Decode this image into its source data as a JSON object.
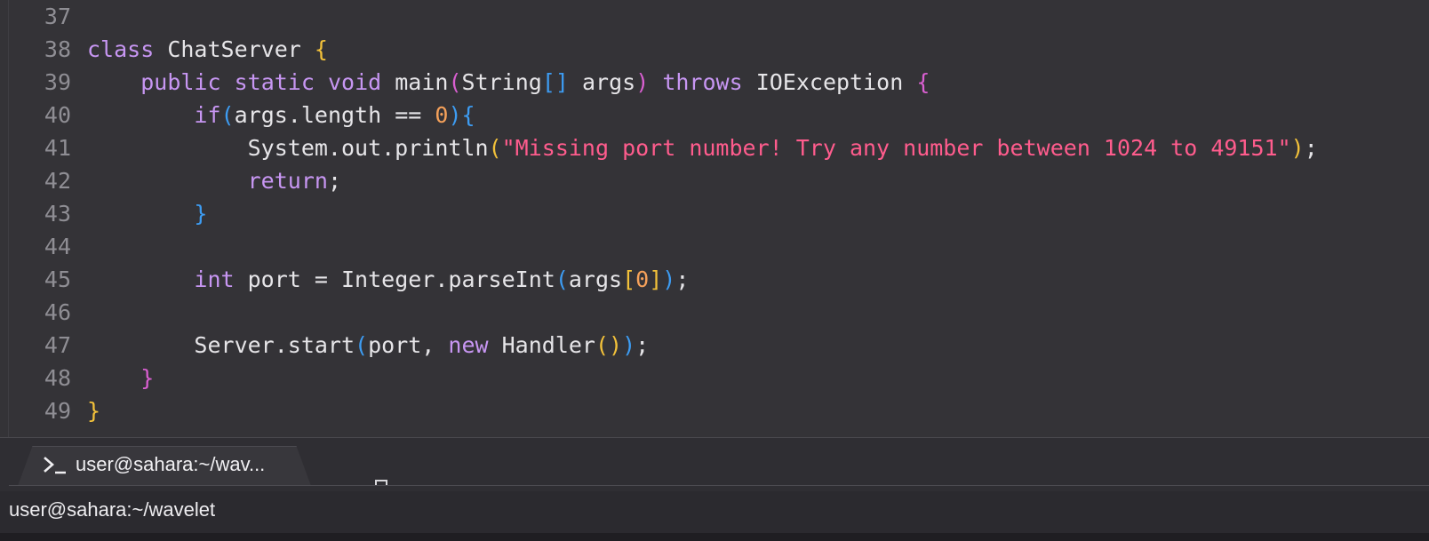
{
  "editor": {
    "lines": [
      {
        "n": "37",
        "tokens": []
      },
      {
        "n": "38",
        "tokens": [
          [
            "kw",
            "class"
          ],
          [
            "pt",
            " ChatServer "
          ],
          [
            "py",
            "{"
          ]
        ]
      },
      {
        "n": "39",
        "tokens": [
          [
            "pt",
            "    "
          ],
          [
            "kw",
            "public"
          ],
          [
            "pt",
            " "
          ],
          [
            "kw",
            "static"
          ],
          [
            "pt",
            " "
          ],
          [
            "kw",
            "void"
          ],
          [
            "pt",
            " main"
          ],
          [
            "pp",
            "("
          ],
          [
            "pt",
            "String"
          ],
          [
            "pb",
            "[]"
          ],
          [
            "pt",
            " args"
          ],
          [
            "pp",
            ")"
          ],
          [
            "pt",
            " "
          ],
          [
            "kw",
            "throws"
          ],
          [
            "pt",
            " IOException "
          ],
          [
            "pp",
            "{"
          ]
        ]
      },
      {
        "n": "40",
        "tokens": [
          [
            "pt",
            "        "
          ],
          [
            "kw",
            "if"
          ],
          [
            "pb",
            "("
          ],
          [
            "pt",
            "args.length == "
          ],
          [
            "nu",
            "0"
          ],
          [
            "pb",
            "){"
          ]
        ]
      },
      {
        "n": "41",
        "tokens": [
          [
            "pt",
            "            System.out.println"
          ],
          [
            "py",
            "("
          ],
          [
            "st",
            "\"Missing port number! Try any number between 1024 to 49151\""
          ],
          [
            "py",
            ")"
          ],
          [
            "pt",
            ";"
          ]
        ]
      },
      {
        "n": "42",
        "tokens": [
          [
            "pt",
            "            "
          ],
          [
            "kw",
            "return"
          ],
          [
            "pt",
            ";"
          ]
        ]
      },
      {
        "n": "43",
        "tokens": [
          [
            "pt",
            "        "
          ],
          [
            "pb",
            "}"
          ]
        ]
      },
      {
        "n": "44",
        "tokens": []
      },
      {
        "n": "45",
        "tokens": [
          [
            "pt",
            "        "
          ],
          [
            "kw",
            "int"
          ],
          [
            "pt",
            " port = Integer.parseInt"
          ],
          [
            "pb",
            "("
          ],
          [
            "pt",
            "args"
          ],
          [
            "py",
            "["
          ],
          [
            "nu",
            "0"
          ],
          [
            "py",
            "]"
          ],
          [
            "pb",
            ")"
          ],
          [
            "pt",
            ";"
          ]
        ]
      },
      {
        "n": "46",
        "tokens": []
      },
      {
        "n": "47",
        "tokens": [
          [
            "pt",
            "        Server.start"
          ],
          [
            "pb",
            "("
          ],
          [
            "pt",
            "port, "
          ],
          [
            "kw",
            "new"
          ],
          [
            "pt",
            " Handler"
          ],
          [
            "py",
            "()"
          ],
          [
            "pb",
            ")"
          ],
          [
            "pt",
            ";"
          ]
        ]
      },
      {
        "n": "48",
        "tokens": [
          [
            "pt",
            "    "
          ],
          [
            "pp",
            "}"
          ]
        ]
      },
      {
        "n": "49",
        "tokens": [
          [
            "py",
            "}"
          ]
        ]
      }
    ]
  },
  "terminal_tab": {
    "icon": "terminal-prompt-icon",
    "label": "user@sahara:~/wav..."
  },
  "terminal": {
    "title": "user@sahara:~/wavelet"
  },
  "colors": {
    "keyword": "#c796f2",
    "string": "#ff5c8d",
    "number": "#f5a15a",
    "bracket_yellow": "#f2c13a",
    "bracket_blue": "#3d9cf2",
    "bracket_pink": "#d95fd1",
    "text": "#e6e5e8",
    "line_number": "#8f8e94"
  }
}
